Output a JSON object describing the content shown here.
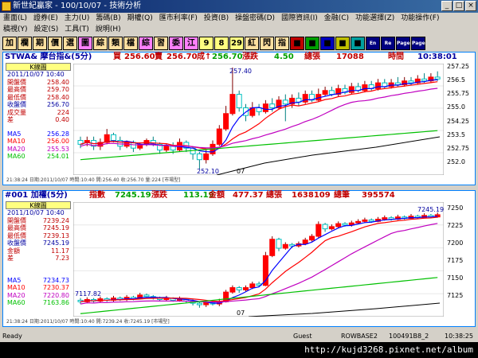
{
  "window": {
    "title": "新世紀贏家 - 100/10/07 - 技術分析"
  },
  "menu_row1": [
    "畫面(L)",
    "證券(E)",
    "主力(U)",
    "籌碼(B)",
    "期權(Q)",
    "匯市利率(F)",
    "投資(B)",
    "操盤密碼(D)",
    "國際資訊(I)",
    "金融(C)",
    "功能選擇(Z)",
    "功能操作(F)"
  ],
  "menu_row2": [
    "稿視(Y)",
    "設定(S)",
    "工具(T)",
    "說明(H)"
  ],
  "toolbar": [
    "加",
    "欄",
    "期",
    "價",
    "選",
    "圖",
    "綜",
    "類",
    "檔",
    "綜",
    "習",
    "委",
    "江",
    "9",
    "8",
    "29",
    "紅",
    "閃",
    "指",
    "■",
    "■",
    "■",
    "■",
    "■",
    "En",
    "Re",
    "Page",
    "Page"
  ],
  "panel1": {
    "name": "STWA& 摩台指&(5分)",
    "buy_label": "買",
    "buy": "256.60",
    "sell_label": "賣",
    "sell": "256.70",
    "deal_label": "成↑",
    "deal": "256.70",
    "change_label": "漲跌",
    "change": "4.50",
    "volume_label": "總張",
    "volume": "17088",
    "time_label": "時間",
    "time": "10:38:01",
    "box_title": "K線圖",
    "date": "2011/10/07 10:40",
    "rows": [
      [
        "開盤價",
        "258.40"
      ],
      [
        "最高價",
        "259.70"
      ],
      [
        "最低價",
        "258.40"
      ],
      [
        "收盤價",
        "256.70"
      ],
      [
        "成交量",
        "224"
      ],
      [
        "差",
        "0.40"
      ]
    ],
    "ma": [
      [
        "MA5",
        "256.28"
      ],
      [
        "MA10",
        "256.00"
      ],
      [
        "MA20",
        "255.53"
      ],
      [
        "MA60",
        "254.01"
      ]
    ],
    "y_ticks": [
      "257.25",
      "256.5",
      "255.75",
      "255.0",
      "254.25",
      "253.5",
      "252.75",
      "252.0"
    ],
    "high_label": "257.40",
    "low_label": "252.10",
    "x_label": "07",
    "foot": "21:38:24 日期:2011/10/07 時間:10:40 開:256.40 收:256.70 量:224 [市場型]"
  },
  "panel2": {
    "name": "#001 加權(5分)",
    "index_label": "指數",
    "index": "7245.19",
    "change_label": "漲跌",
    "change": "113.19",
    "amount_label": "金額",
    "amount": "477.37",
    "vol_label": "總張",
    "vol": "1638109",
    "count_label": "總筆",
    "count": "395574",
    "box_title": "K線圖",
    "date": "2011/10/07 10:40",
    "rows": [
      [
        "開盤價",
        "7239.24"
      ],
      [
        "最高價",
        "7245.19"
      ],
      [
        "最低價",
        "7239.13"
      ],
      [
        "收盤價",
        "7245.19"
      ],
      [
        "金額",
        "11.17"
      ],
      [
        "差",
        "7.23"
      ]
    ],
    "ma": [
      [
        "MA5",
        "7234.73"
      ],
      [
        "MA10",
        "7230.37"
      ],
      [
        "MA20",
        "7220.80"
      ],
      [
        "MA60",
        "7163.86"
      ]
    ],
    "y_ticks": [
      "7250",
      "7225",
      "7200",
      "7175",
      "7150",
      "7125"
    ],
    "high_label": "7245.19",
    "low_label": "7117.82",
    "x_label": "07",
    "foot": "21:38:24 日期:2011/10/07 時間:10:40 開:7239.24 收:7245.19 [市場型]"
  },
  "status": {
    "left": "Ready",
    "user": "Guest",
    "server": "ROWBASE2",
    "code": "100491B8_2",
    "time": "10:38:25"
  },
  "watermark": "http://kujd3268.pixnet.net/album",
  "colors": {
    "ma5": "#0000ff",
    "ma10": "#ff0000",
    "ma20": "#c000c0",
    "ma60": "#00c000",
    "up": "#ff0000",
    "down": "#00c0c0"
  }
}
